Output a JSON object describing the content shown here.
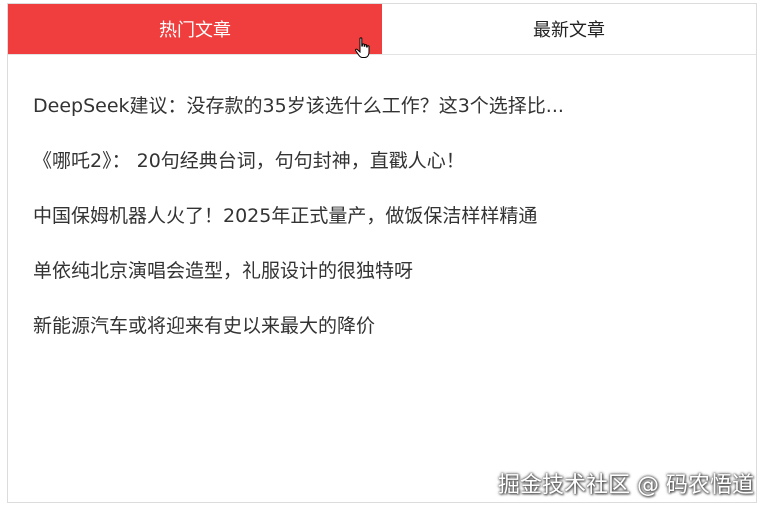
{
  "tabs": [
    {
      "label": "热门文章",
      "active": true
    },
    {
      "label": "最新文章",
      "active": false
    }
  ],
  "articles": [
    "DeepSeek建议：没存款的35岁该选什么工作？这3个选择比...",
    "《哪吒2》： 20句经典台词，句句封神，直戳人心！",
    "中国保姆机器人火了！2025年正式量产，做饭保洁样样精通",
    "单依纯北京演唱会造型，礼服设计的很独特呀",
    "新能源汽车或将迎来有史以来最大的降价"
  ],
  "watermark": "掘金技术社区 @ 码农悟道",
  "colors": {
    "active_tab_bg": "#f03e3e",
    "active_tab_text": "#ffffff",
    "text": "#333333"
  },
  "cursor_icon": "hand-pointer-icon"
}
